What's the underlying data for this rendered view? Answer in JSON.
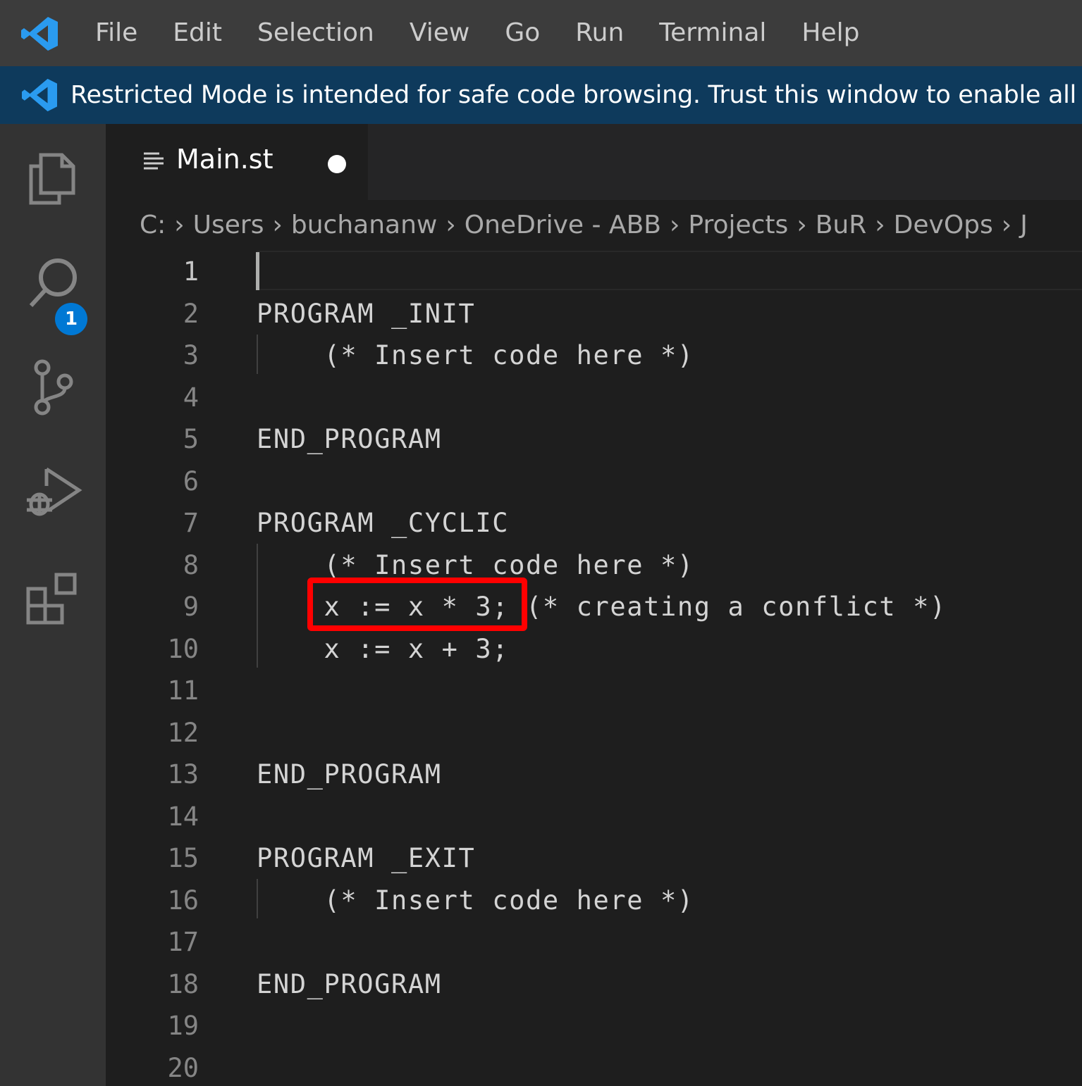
{
  "menu": {
    "items": [
      "File",
      "Edit",
      "Selection",
      "View",
      "Go",
      "Run",
      "Terminal",
      "Help"
    ]
  },
  "banner": {
    "text": "Restricted Mode is intended for safe code browsing. Trust this window to enable all features."
  },
  "activity": {
    "explorer_badge": "1"
  },
  "tab": {
    "label": "Main.st",
    "dirty": true
  },
  "breadcrumb": [
    "C:",
    "Users",
    "buchananw",
    "OneDrive - ABB",
    "Projects",
    "BuR",
    "DevOps",
    "J"
  ],
  "editor": {
    "active_line": 1,
    "lines": [
      {
        "n": "1",
        "text": ""
      },
      {
        "n": "2",
        "text": "PROGRAM _INIT"
      },
      {
        "n": "3",
        "text": "    (* Insert code here *)"
      },
      {
        "n": "4",
        "text": ""
      },
      {
        "n": "5",
        "text": "END_PROGRAM"
      },
      {
        "n": "6",
        "text": ""
      },
      {
        "n": "7",
        "text": "PROGRAM _CYCLIC"
      },
      {
        "n": "8",
        "text": "    (* Insert code here *)"
      },
      {
        "n": "9",
        "text": "    x := x * 3; (* creating a conflict *)"
      },
      {
        "n": "10",
        "text": "    x := x + 3;"
      },
      {
        "n": "11",
        "text": ""
      },
      {
        "n": "12",
        "text": ""
      },
      {
        "n": "13",
        "text": "END_PROGRAM"
      },
      {
        "n": "14",
        "text": ""
      },
      {
        "n": "15",
        "text": "PROGRAM _EXIT"
      },
      {
        "n": "16",
        "text": "    (* Insert code here *)"
      },
      {
        "n": "17",
        "text": ""
      },
      {
        "n": "18",
        "text": "END_PROGRAM"
      },
      {
        "n": "19",
        "text": ""
      },
      {
        "n": "20",
        "text": ""
      }
    ]
  },
  "colors": {
    "highlight": "#ff0000",
    "banner_bg": "#0e3a5c",
    "badge": "#0078d4",
    "vscode_blue": "#2a9bf0"
  }
}
